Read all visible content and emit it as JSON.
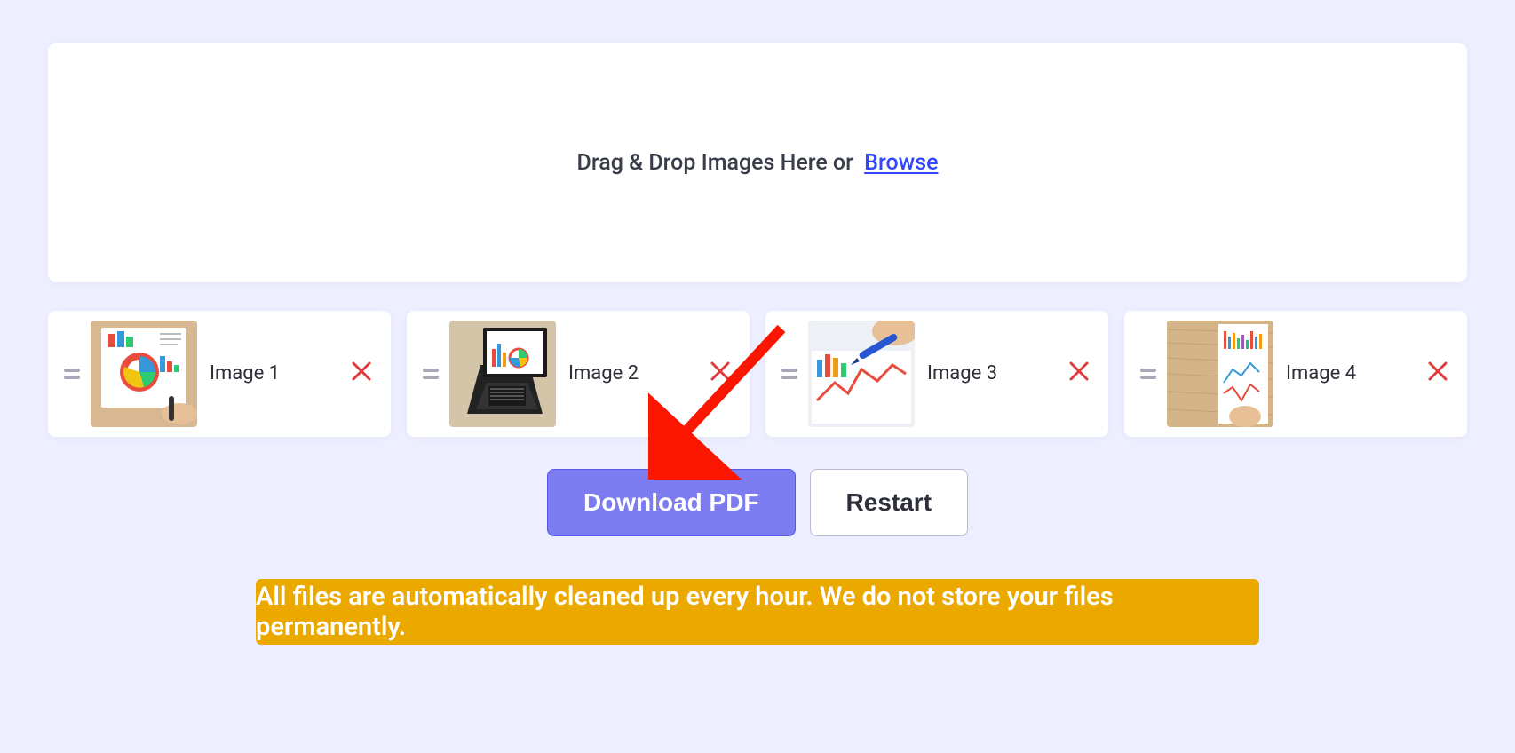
{
  "dropzone": {
    "text": "Drag & Drop Images Here or",
    "browse": "Browse"
  },
  "images": [
    {
      "label": "Image 1"
    },
    {
      "label": "Image 2"
    },
    {
      "label": "Image 3"
    },
    {
      "label": "Image 4"
    }
  ],
  "actions": {
    "download": "Download PDF",
    "restart": "Restart"
  },
  "banner": "All files are automatically cleaned up every hour. We do not store your files permanently."
}
